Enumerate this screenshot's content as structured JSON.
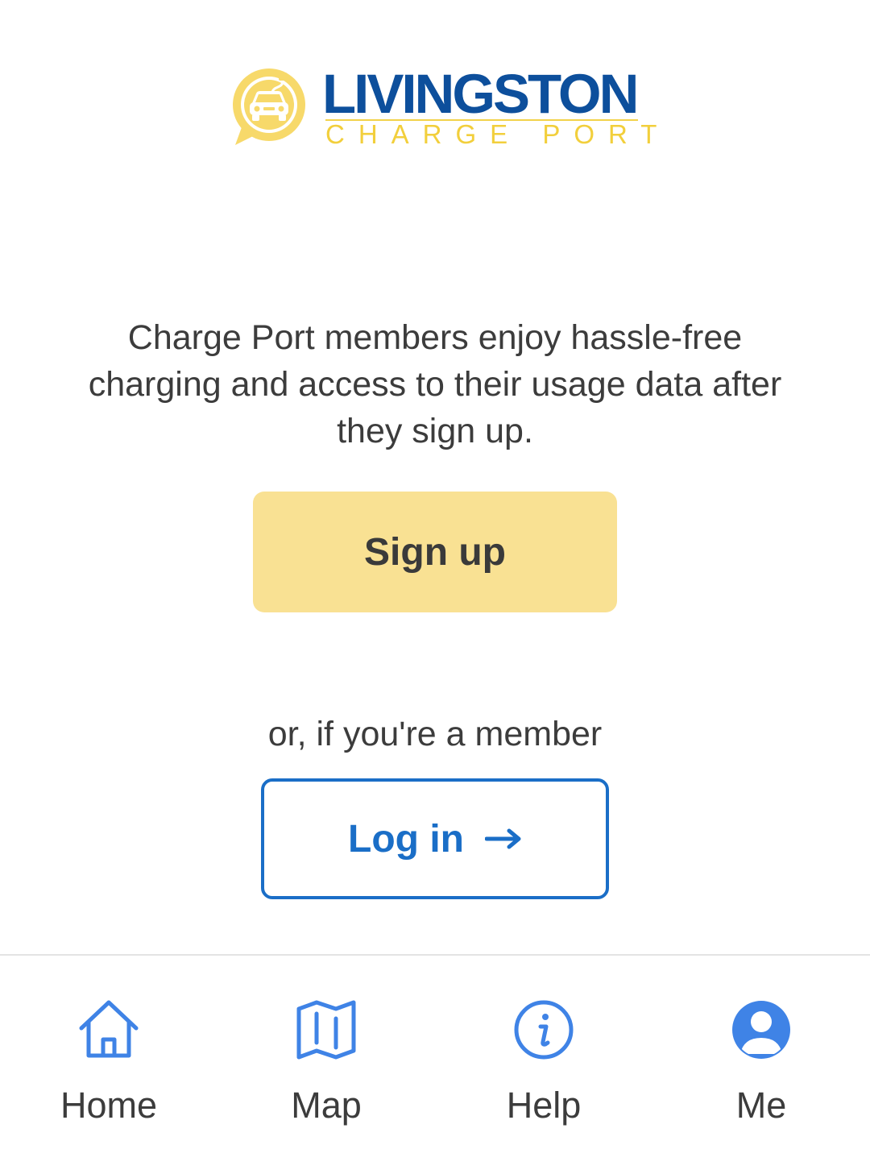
{
  "logo": {
    "brand": "LIVINGSTON",
    "subtitle": "CHARGE PORT"
  },
  "intro": {
    "text": "Charge Port members enjoy hassle-free charging and access to their usage data after they sign up."
  },
  "signup": {
    "label": "Sign up"
  },
  "member_prompt": {
    "text": "or, if you're a member"
  },
  "login": {
    "label": "Log in",
    "arrow_icon": "arrow-right-icon"
  },
  "colors": {
    "brand_blue": "#0d4f9c",
    "brand_yellow": "#f2cf3c",
    "signup_bg": "#f9e193",
    "link_blue": "#1a6ec7",
    "nav_icon_blue": "#3f83e6",
    "text": "#3c3c3c"
  },
  "bottom_nav": {
    "items": [
      {
        "label": "Home",
        "icon": "home-icon"
      },
      {
        "label": "Map",
        "icon": "map-icon"
      },
      {
        "label": "Help",
        "icon": "info-icon"
      },
      {
        "label": "Me",
        "icon": "user-icon"
      }
    ]
  }
}
